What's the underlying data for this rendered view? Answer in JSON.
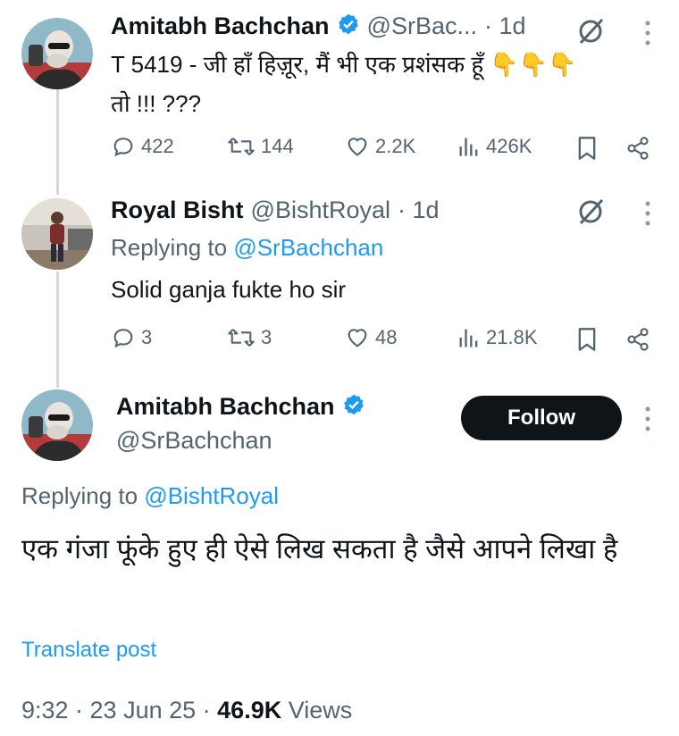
{
  "tweet1": {
    "name": "Amitabh Bachchan",
    "handle": "@SrBac...",
    "time": "· 1d",
    "text_line1": "T 5419 - जी हाँ हिज़ूर, मैं भी एक प्रशंसक हूँ",
    "emoji": "👇👇👇",
    "text_line2": "तो !!! ???",
    "replies": "422",
    "reposts": "144",
    "likes": "2.2K",
    "views": "426K"
  },
  "tweet2": {
    "name": "Royal Bisht",
    "handle": "@BishtRoyal",
    "time": "· 1d",
    "replying_prefix": "Replying to",
    "replying_handle": "@SrBachchan",
    "text": "Solid ganja fukte ho sir",
    "replies": "3",
    "reposts": "3",
    "likes": "48",
    "views": "21.8K"
  },
  "tweet3": {
    "name": "Amitabh Bachchan",
    "handle": "@SrBachchan",
    "follow_label": "Follow",
    "replying_prefix": "Replying to",
    "replying_handle": "@BishtRoyal",
    "text": "एक गंजा फूंके हुए ही ऐसे लिख सकता है जैसे आपने लिखा है",
    "translate_label": "Translate post",
    "time": "9:32 · 23 Jun 25 ·",
    "views_count": "46.9K",
    "views_label": "Views"
  },
  "colors": {
    "text": "#0f1419",
    "secondary": "#536471",
    "link": "#1d9bf0",
    "translate": "#1d9bf0",
    "verified": "#1d9bf0",
    "thread_line": "#cfd9de",
    "follow_bg": "#0f1419"
  }
}
